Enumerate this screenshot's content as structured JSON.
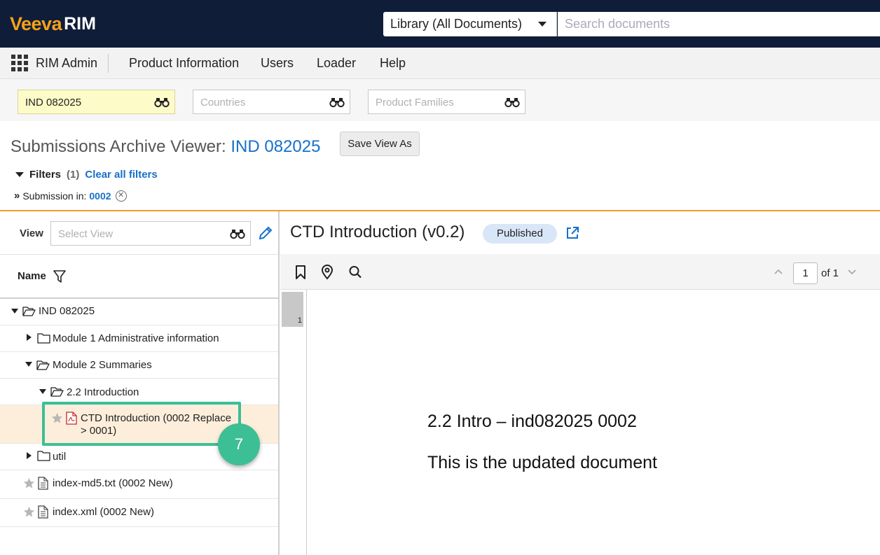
{
  "brand": {
    "veeva": "Veeva",
    "rim": "RIM",
    "accent": "#f5a01a",
    "topbar_color": "#0f1d38"
  },
  "search": {
    "scope": "Library (All Documents)",
    "placeholder": "Search documents"
  },
  "nav": {
    "app_name": "RIM Admin",
    "items": [
      "Product Information",
      "Users",
      "Loader",
      "Help"
    ]
  },
  "filter_fields": [
    {
      "value": "IND 082025",
      "placeholder": ""
    },
    {
      "value": "",
      "placeholder": "Countries"
    },
    {
      "value": "",
      "placeholder": "Product Families"
    }
  ],
  "page": {
    "title_prefix": "Submissions Archive Viewer:",
    "title_link": "IND 082025",
    "save_view_label": "Save View As",
    "filters_label": "Filters",
    "filters_count": "(1)",
    "clear_filters": "Clear all filters",
    "submission_label": "Submission in:",
    "submission_value": "0002"
  },
  "left_panel": {
    "view_label": "View",
    "view_placeholder": "Select View",
    "name_header": "Name",
    "tree": [
      {
        "label": "IND 082025",
        "icon": "folder-open-icon",
        "expanded": true
      },
      {
        "label": "Module 1 Administrative information",
        "icon": "folder-icon",
        "expanded": false
      },
      {
        "label": "Module 2 Summaries",
        "icon": "folder-open-icon",
        "expanded": true
      },
      {
        "label": "2.2 Introduction",
        "icon": "folder-open-icon",
        "expanded": true
      },
      {
        "label_line1": "CTD Introduction (0002 Replace",
        "label_line2": "> 0001)",
        "icon": "pdf-icon",
        "selected": true
      },
      {
        "label": "util",
        "icon": "folder-icon",
        "expanded": false
      },
      {
        "label": "index-md5.txt (0002 New)",
        "icon": "text-file-icon"
      },
      {
        "label": "index.xml (0002 New)",
        "icon": "text-file-icon"
      }
    ]
  },
  "callout": {
    "step": "7",
    "color": "#3dbf95"
  },
  "viewer": {
    "doc_title": "CTD Introduction (v0.2)",
    "status": "Published",
    "page_current": "1",
    "page_total": "of 1",
    "thumb_label": "1",
    "content_line1": "2.2 Intro – ind082025 0002",
    "content_line2": "This is the updated document"
  }
}
